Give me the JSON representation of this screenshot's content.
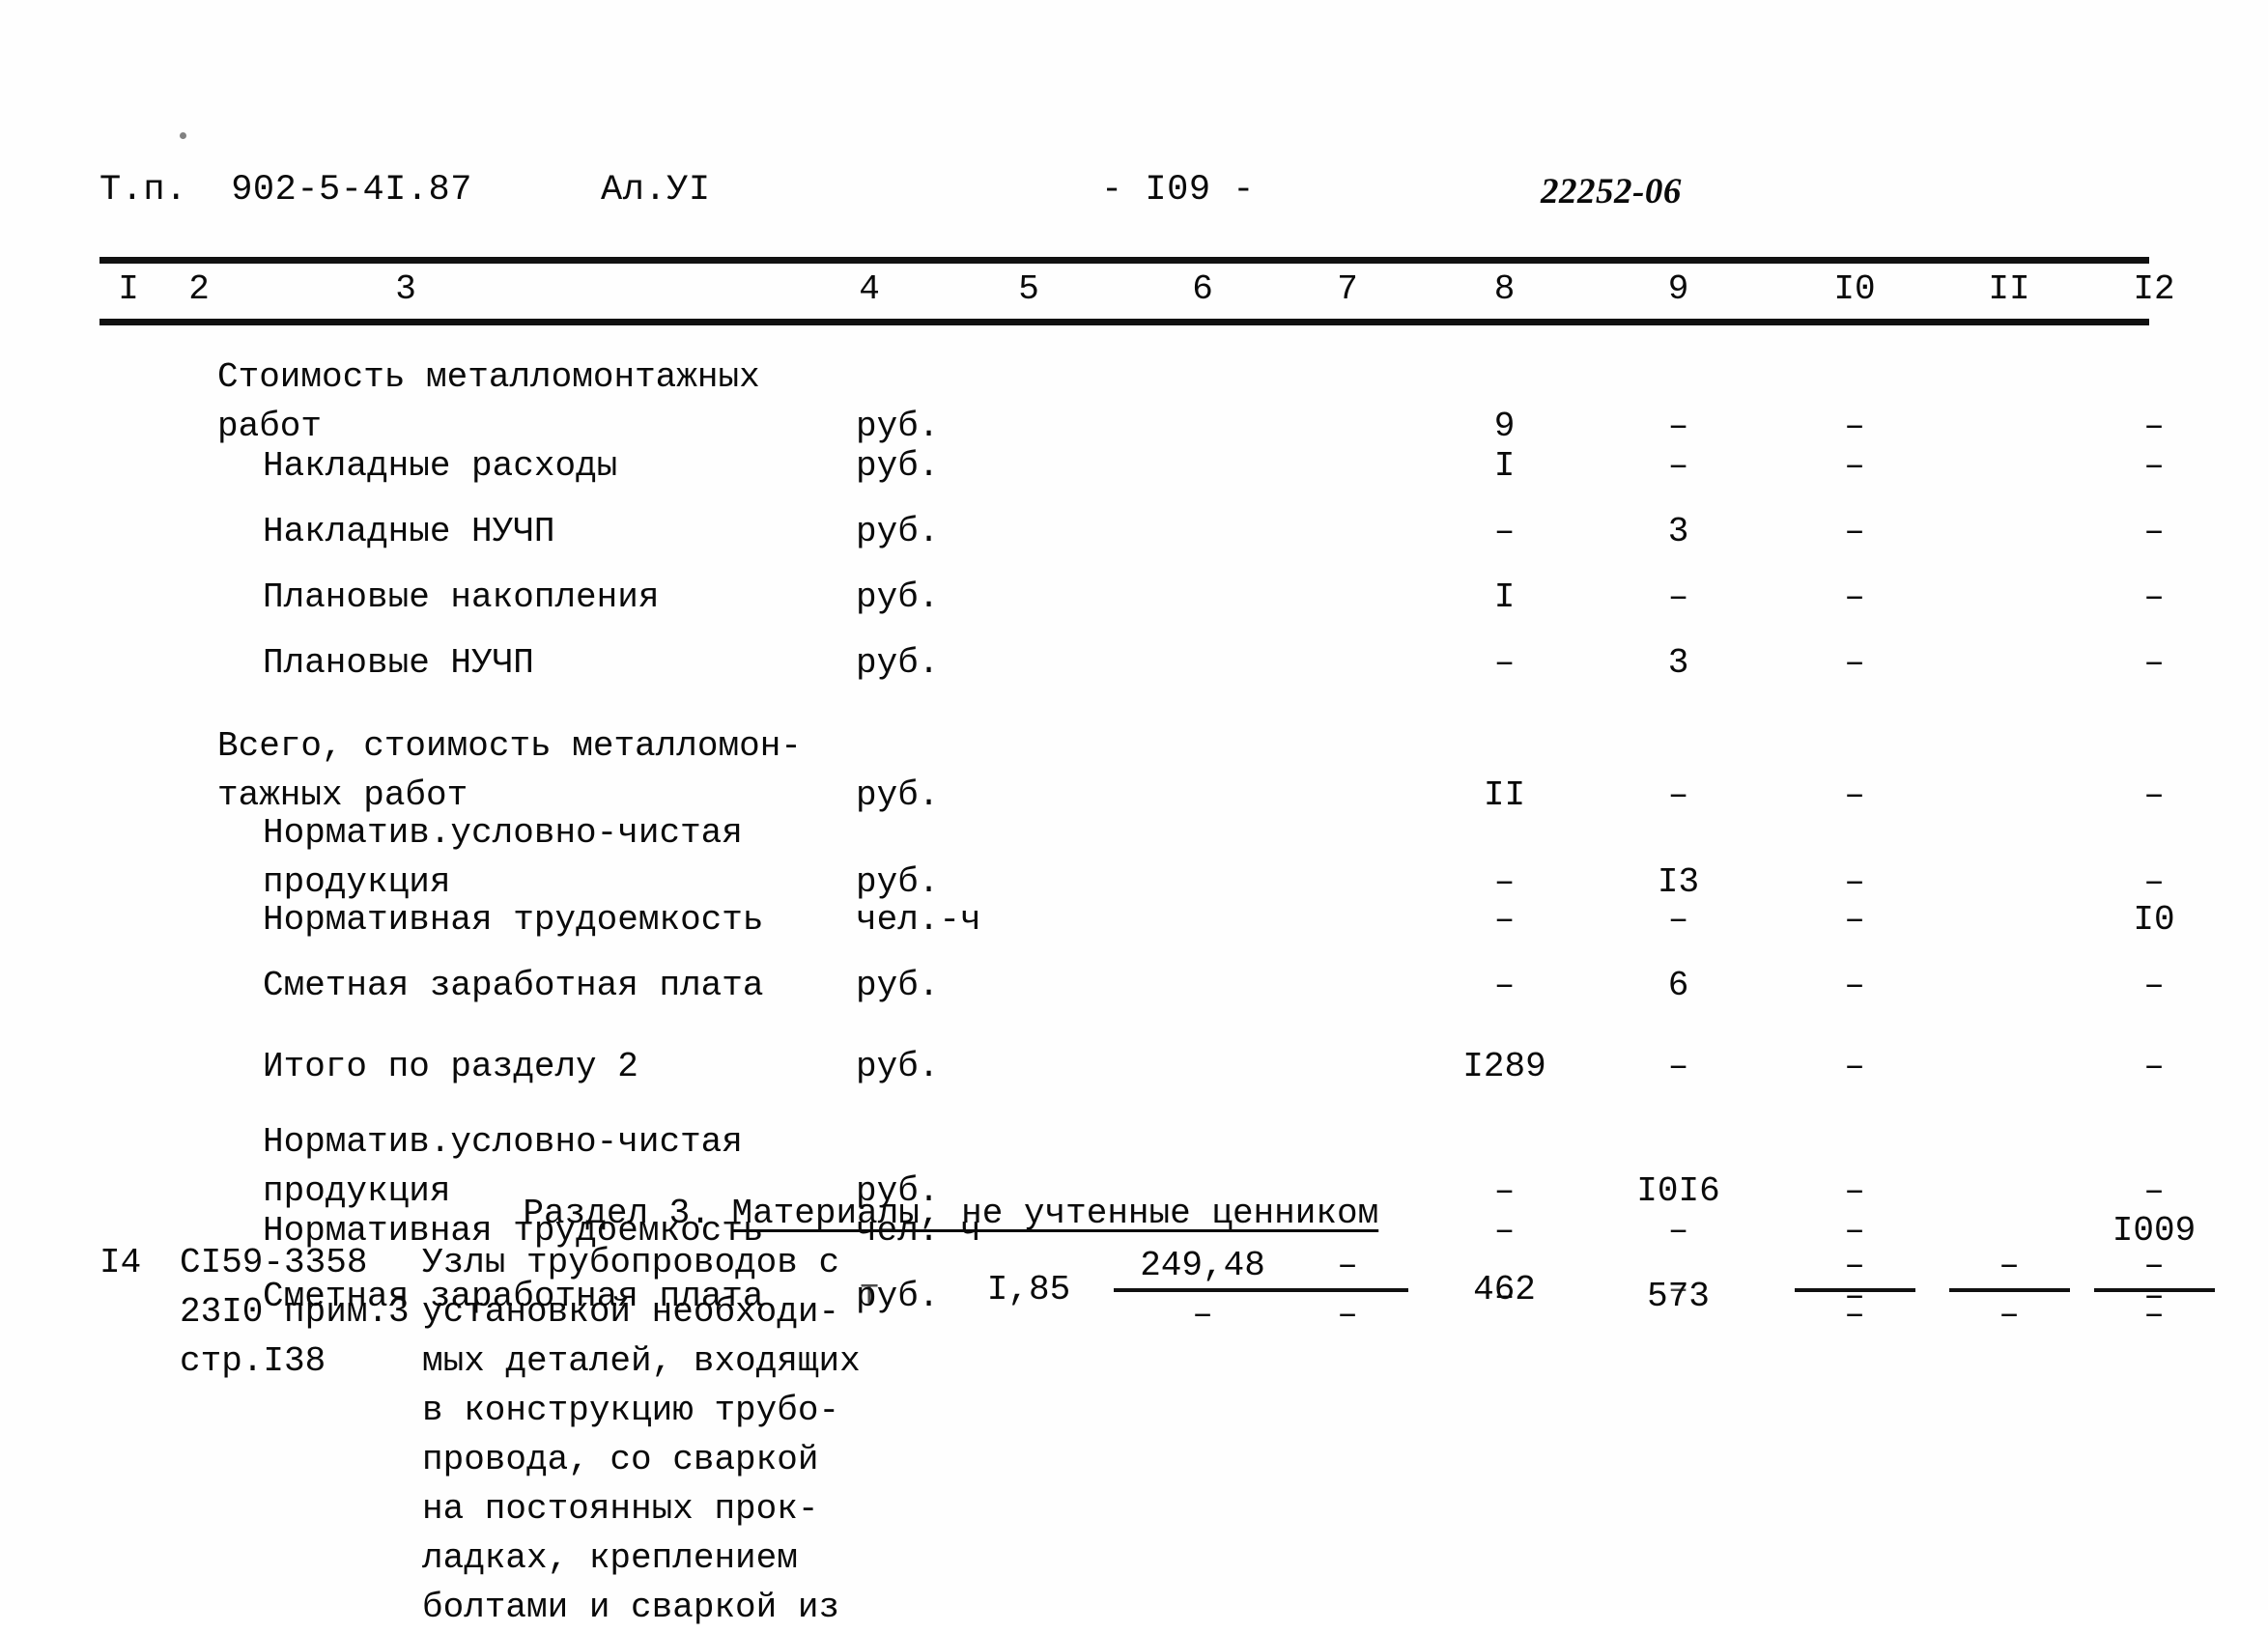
{
  "header": {
    "type_project": "Т.п.  902-5-4I.87",
    "album": "Ал.УI",
    "page_number": "- I09 -",
    "doc_code": "22252-06"
  },
  "column_numbers": [
    "I",
    "2",
    "3",
    "4",
    "5",
    "6",
    "7",
    "8",
    "9",
    "I0",
    "II",
    "I2"
  ],
  "rows": [
    {
      "desc": "Стоимость металломонтажных\nработ",
      "indent": false,
      "unit": "руб.",
      "c4": "",
      "c5": "",
      "c6": "",
      "c7": "",
      "c8": "9",
      "c9": "–",
      "c10": "–",
      "c11": "",
      "c12": "–"
    },
    {
      "desc": "Накладные расходы",
      "indent": true,
      "unit": "руб.",
      "c4": "",
      "c5": "",
      "c6": "",
      "c7": "",
      "c8": "I",
      "c9": "–",
      "c10": "–",
      "c11": "",
      "c12": "–"
    },
    {
      "desc": "Накладные НУЧП",
      "indent": true,
      "unit": "руб.",
      "c4": "",
      "c5": "",
      "c6": "",
      "c7": "",
      "c8": "–",
      "c9": "3",
      "c10": "–",
      "c11": "",
      "c12": "–"
    },
    {
      "desc": "Плановые накопления",
      "indent": true,
      "unit": "руб.",
      "c4": "",
      "c5": "",
      "c6": "",
      "c7": "",
      "c8": "I",
      "c9": "–",
      "c10": "–",
      "c11": "",
      "c12": "–"
    },
    {
      "desc": "Плановые НУЧП",
      "indent": true,
      "unit": "руб.",
      "c4": "",
      "c5": "",
      "c6": "",
      "c7": "",
      "c8": "–",
      "c9": "3",
      "c10": "–",
      "c11": "",
      "c12": "–"
    },
    {
      "desc": "Всего, стоимость металломон-\nтажных работ",
      "indent": false,
      "unit": "руб.",
      "c4": "",
      "c5": "",
      "c6": "",
      "c7": "",
      "c8": "II",
      "c9": "–",
      "c10": "–",
      "c11": "",
      "c12": "–"
    },
    {
      "desc": "Норматив.условно-чистая\nпродукция",
      "indent": true,
      "unit": "руб.",
      "c4": "",
      "c5": "",
      "c6": "",
      "c7": "",
      "c8": "–",
      "c9": "I3",
      "c10": "–",
      "c11": "",
      "c12": "–"
    },
    {
      "desc": "Нормативная трудоемкость",
      "indent": true,
      "unit": "чел.-ч",
      "c4": "",
      "c5": "",
      "c6": "",
      "c7": "",
      "c8": "–",
      "c9": "–",
      "c10": "–",
      "c11": "",
      "c12": "I0"
    },
    {
      "desc": "Сметная заработная плата",
      "indent": true,
      "unit": "руб.",
      "c4": "",
      "c5": "",
      "c6": "",
      "c7": "",
      "c8": "–",
      "c9": "6",
      "c10": "–",
      "c11": "",
      "c12": "–"
    },
    {
      "desc": "Итого по разделу 2",
      "indent": true,
      "unit": "руб.",
      "c4": "",
      "c5": "",
      "c6": "",
      "c7": "",
      "c8": "I289",
      "c9": "–",
      "c10": "–",
      "c11": "",
      "c12": "–"
    },
    {
      "desc": "Норматив.условно-чистая\nпродукция",
      "indent": true,
      "unit": "руб.",
      "c4": "",
      "c5": "",
      "c6": "",
      "c7": "",
      "c8": "–",
      "c9": "I0I6",
      "c10": "–",
      "c11": "",
      "c12": "–"
    },
    {
      "desc": "Нормативная трудоемкость",
      "indent": true,
      "unit": "чел.-ч",
      "c4": "",
      "c5": "",
      "c6": "",
      "c7": "",
      "c8": "–",
      "c9": "–",
      "c10": "–",
      "c11": "",
      "c12": "I009"
    },
    {
      "desc": "Сметная заработная плата",
      "indent": true,
      "unit": "руб.",
      "c4": "",
      "c5": "",
      "c6": "",
      "c7": "",
      "c8": "–",
      "c9": "573",
      "c10": "–",
      "c11": "",
      "c12": "–"
    }
  ],
  "section": {
    "prefix": "Раздел 3. ",
    "underlined": "Материалы, не учтенные ценником"
  },
  "material_row": {
    "number": "I4",
    "code": "СI59-3358\n23I0 прим.3\nстр.I38",
    "name": "Узлы трубопроводов с\nустановкой необходи-\nмых деталей, входящих\nв конструкцию трубо-\nпровода, со сваркой\nна постоянных прок-\nладках, креплением\nболтами и сваркой из",
    "unit": "т",
    "qty": "I,85",
    "price_num": "249,48",
    "price_den": "–",
    "c7_num": "–",
    "c7_den": "–",
    "total": "462",
    "c9": "–",
    "c10_num": "–",
    "c10_den": "–",
    "c11_num": "–",
    "c11_den": "–",
    "c12_num": "–",
    "c12_den": "–"
  }
}
